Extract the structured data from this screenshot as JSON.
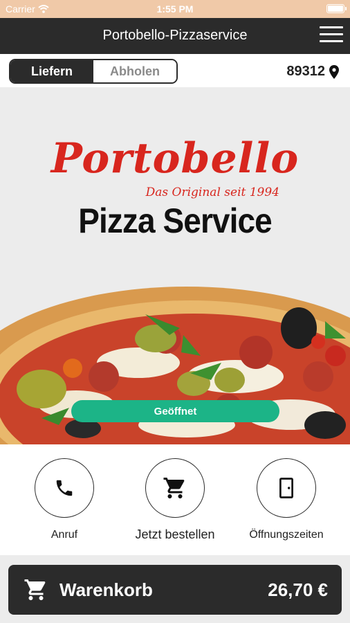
{
  "status_bar": {
    "carrier": "Carrier",
    "time": "1:55 PM"
  },
  "nav": {
    "title": "Portobello-Pizzaservice",
    "menu_icon": "hamburger-menu-icon"
  },
  "mode": {
    "deliver_label": "Liefern",
    "pickup_label": "Abholen",
    "selected": "Liefern"
  },
  "location": {
    "zip": "89312",
    "icon": "location-pin-icon"
  },
  "logo": {
    "script": "Portobello",
    "tagline": "Das Original seit 1994",
    "subtitle": "Pizza Service"
  },
  "hero": {
    "status_button": "Geöffnet",
    "status_color": "#1cb487"
  },
  "actions": [
    {
      "label": "Anruf",
      "icon": "phone-icon"
    },
    {
      "label": "Jetzt bestellen",
      "icon": "cart-icon"
    },
    {
      "label": "Öffnungszeiten",
      "icon": "door-icon"
    }
  ],
  "cart": {
    "label": "Warenkorb",
    "amount": "26,70 €",
    "icon": "cart-icon"
  },
  "colors": {
    "primary_dark": "#2b2b2b",
    "brand_red": "#d8261e",
    "open_green": "#1cb487",
    "status_bar": "#f0c9a8"
  }
}
